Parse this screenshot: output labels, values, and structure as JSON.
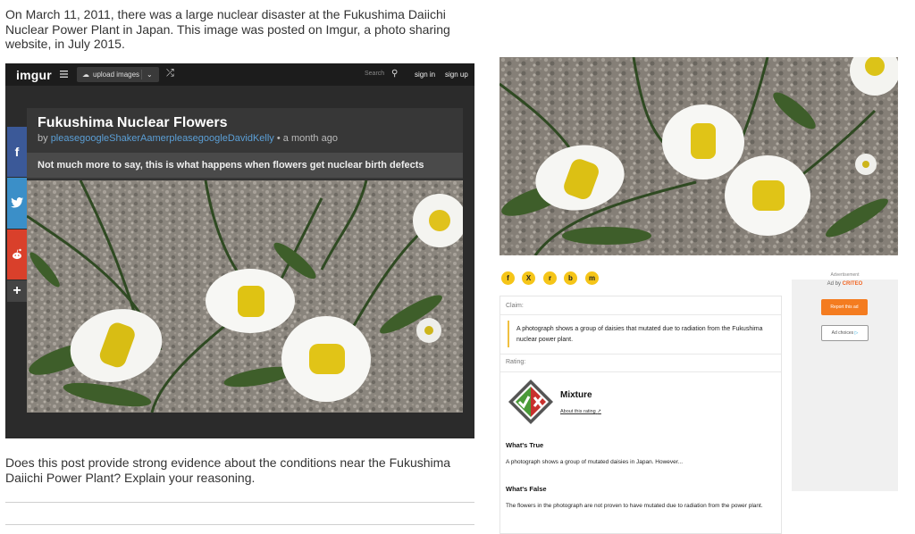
{
  "intro_text": "On March 11, 2011, there was a large nuclear disaster at the Fukushima Daiichi Nuclear Power Plant in Japan. This image was posted on Imgur, a photo sharing website, in July 2015.",
  "question_text": "Does this post provide strong evidence about the conditions near the Fukushima Daiichi Power Plant? Explain your reasoning.",
  "imgur": {
    "logo": "imgur",
    "upload_label": "upload images",
    "search_placeholder": "Search",
    "sign_in": "sign in",
    "sign_up": "sign up",
    "share_facebook": "f",
    "share_plus": "+",
    "post_title": "Fukushima Nuclear Flowers",
    "by_prefix": "by",
    "author": "pleasegoogleShakerAamerpleasegoogleDavidKelly",
    "time": "• a month ago",
    "description": "Not much more to say, this is what happens when flowers get nuclear birth defects"
  },
  "snopes": {
    "claim_label": "Claim:",
    "claim_text": "A photograph shows a group of daisies that mutated due to radiation from the Fukushima nuclear power plant.",
    "rating_label": "Rating:",
    "rating_value": "Mixture",
    "about_rating": "About this rating",
    "whats_true_label": "What's True",
    "whats_true_text": "A photograph shows a group of mutated daisies in Japan. However...",
    "whats_false_label": "What's False",
    "whats_false_text": "The flowers in the photograph are not proven to have mutated due to radiation from the power plant.",
    "share_icons": [
      "f",
      "X",
      "r",
      "b",
      "m"
    ]
  },
  "ad": {
    "label": "Advertisement",
    "ad_by_prefix": "Ad by",
    "ad_by_brand": "CRITEO",
    "report_button": "Report this ad",
    "adchoices": "Ad choices"
  },
  "colors": {
    "accent_yellow": "#f5c518",
    "imgur_dark": "#2b2b2b",
    "link_blue": "#5b9fd6",
    "report_orange": "#f47c20"
  }
}
